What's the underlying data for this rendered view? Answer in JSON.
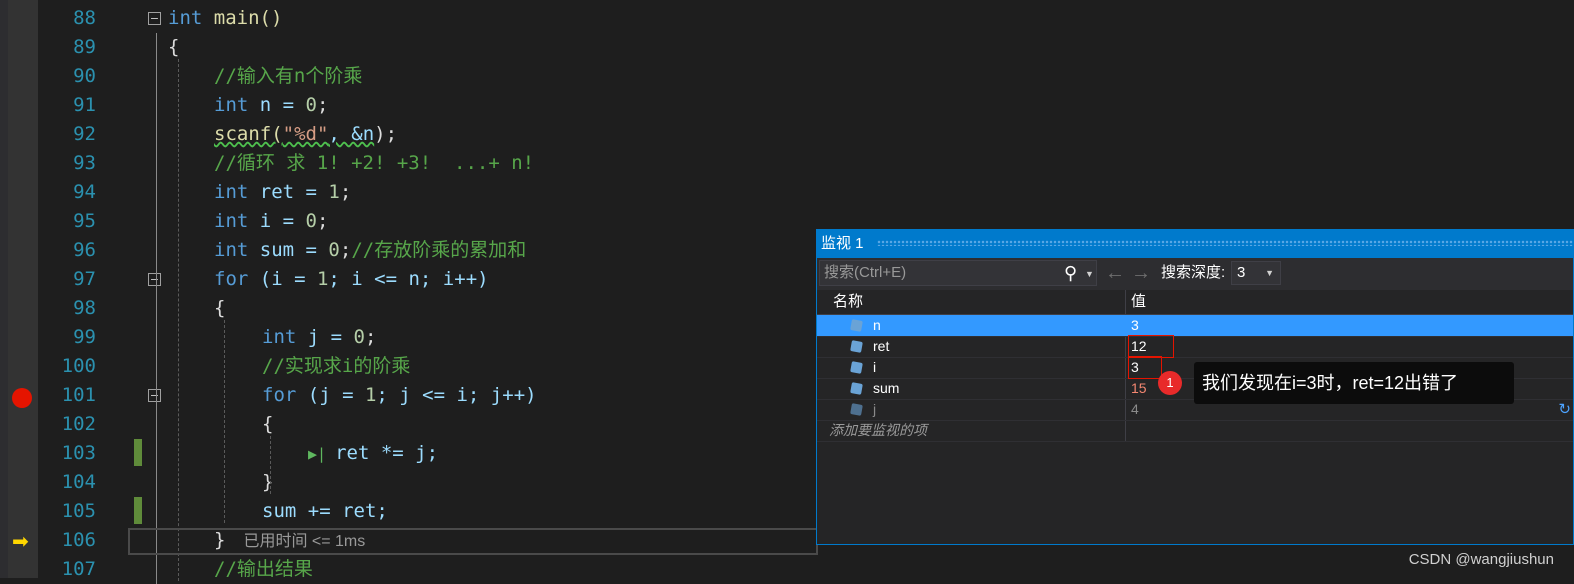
{
  "editor": {
    "lines": [
      {
        "num": "88",
        "segments": [
          {
            "t": "int",
            "c": "kw"
          },
          {
            "t": " main()",
            "c": "fn"
          }
        ]
      },
      {
        "num": "89",
        "segments": [
          {
            "t": "{",
            "c": ""
          }
        ]
      },
      {
        "num": "90",
        "segments": [
          {
            "t": "//输入有n个阶乘",
            "c": "cm"
          }
        ]
      },
      {
        "num": "91",
        "segments": [
          {
            "t": "int",
            "c": "kw"
          },
          {
            "t": " n = ",
            "c": "var"
          },
          {
            "t": "0",
            "c": "num"
          },
          {
            "t": ";",
            "c": ""
          }
        ]
      },
      {
        "num": "92",
        "segments": [
          {
            "t": "scanf(",
            "c": "fn sq"
          },
          {
            "t": "\"%d\"",
            "c": "st sq"
          },
          {
            "t": ", &n",
            "c": "var sq"
          },
          {
            "t": ");",
            "c": ""
          }
        ]
      },
      {
        "num": "93",
        "segments": [
          {
            "t": "//循环 求 1! +2! +3!  ...+ n!",
            "c": "cm"
          }
        ]
      },
      {
        "num": "94",
        "segments": [
          {
            "t": "int",
            "c": "kw"
          },
          {
            "t": " ret = ",
            "c": "var"
          },
          {
            "t": "1",
            "c": "num"
          },
          {
            "t": ";",
            "c": ""
          }
        ]
      },
      {
        "num": "95",
        "segments": [
          {
            "t": "int",
            "c": "kw"
          },
          {
            "t": " i = ",
            "c": "var"
          },
          {
            "t": "0",
            "c": "num"
          },
          {
            "t": ";",
            "c": ""
          }
        ]
      },
      {
        "num": "96",
        "segments": [
          {
            "t": "int",
            "c": "kw"
          },
          {
            "t": " sum = ",
            "c": "var"
          },
          {
            "t": "0",
            "c": "num"
          },
          {
            "t": ";",
            "c": ""
          },
          {
            "t": "//存放阶乘的累加和",
            "c": "cm"
          }
        ]
      },
      {
        "num": "97",
        "segments": [
          {
            "t": "for",
            "c": "kw"
          },
          {
            "t": " (i = ",
            "c": "var"
          },
          {
            "t": "1",
            "c": "num"
          },
          {
            "t": "; i <= n; i++)",
            "c": "var"
          }
        ]
      },
      {
        "num": "98",
        "segments": [
          {
            "t": "{",
            "c": ""
          }
        ]
      },
      {
        "num": "99",
        "segments": [
          {
            "t": "int",
            "c": "kw"
          },
          {
            "t": " j = ",
            "c": "var"
          },
          {
            "t": "0",
            "c": "num"
          },
          {
            "t": ";",
            "c": ""
          }
        ]
      },
      {
        "num": "100",
        "segments": [
          {
            "t": "//实现求i的阶乘",
            "c": "cm"
          }
        ]
      },
      {
        "num": "101",
        "segments": [
          {
            "t": "for",
            "c": "kw"
          },
          {
            "t": " (j = ",
            "c": "var"
          },
          {
            "t": "1",
            "c": "num"
          },
          {
            "t": "; j <= i; j++)",
            "c": "var"
          }
        ]
      },
      {
        "num": "102",
        "segments": [
          {
            "t": "{",
            "c": ""
          }
        ]
      },
      {
        "num": "103",
        "segments": [
          {
            "t": "ret *= j;",
            "c": "var"
          }
        ]
      },
      {
        "num": "104",
        "segments": [
          {
            "t": "}",
            "c": ""
          }
        ]
      },
      {
        "num": "105",
        "segments": [
          {
            "t": "sum += ret;",
            "c": "var"
          }
        ]
      },
      {
        "num": "106",
        "segments": [
          {
            "t": "}",
            "c": ""
          }
        ]
      },
      {
        "num": "107",
        "segments": [
          {
            "t": "//输出结果",
            "c": "cm"
          }
        ]
      }
    ],
    "elapsed_label": "已用时间 <= 1ms"
  },
  "watch": {
    "title": "监视 1",
    "search_placeholder": "搜索(Ctrl+E)",
    "depth_label": "搜索深度:",
    "depth_value": "3",
    "col_name": "名称",
    "col_value": "值",
    "rows": [
      {
        "name": "n",
        "value": "3"
      },
      {
        "name": "ret",
        "value": "12"
      },
      {
        "name": "i",
        "value": "3"
      },
      {
        "name": "sum",
        "value": "15"
      },
      {
        "name": "j",
        "value": "4"
      }
    ],
    "add_item_label": "添加要监视的项"
  },
  "annotation": {
    "number": "1",
    "text": "我们发现在i=3时，ret=12出错了"
  },
  "watermark": "CSDN @wangjiushun"
}
